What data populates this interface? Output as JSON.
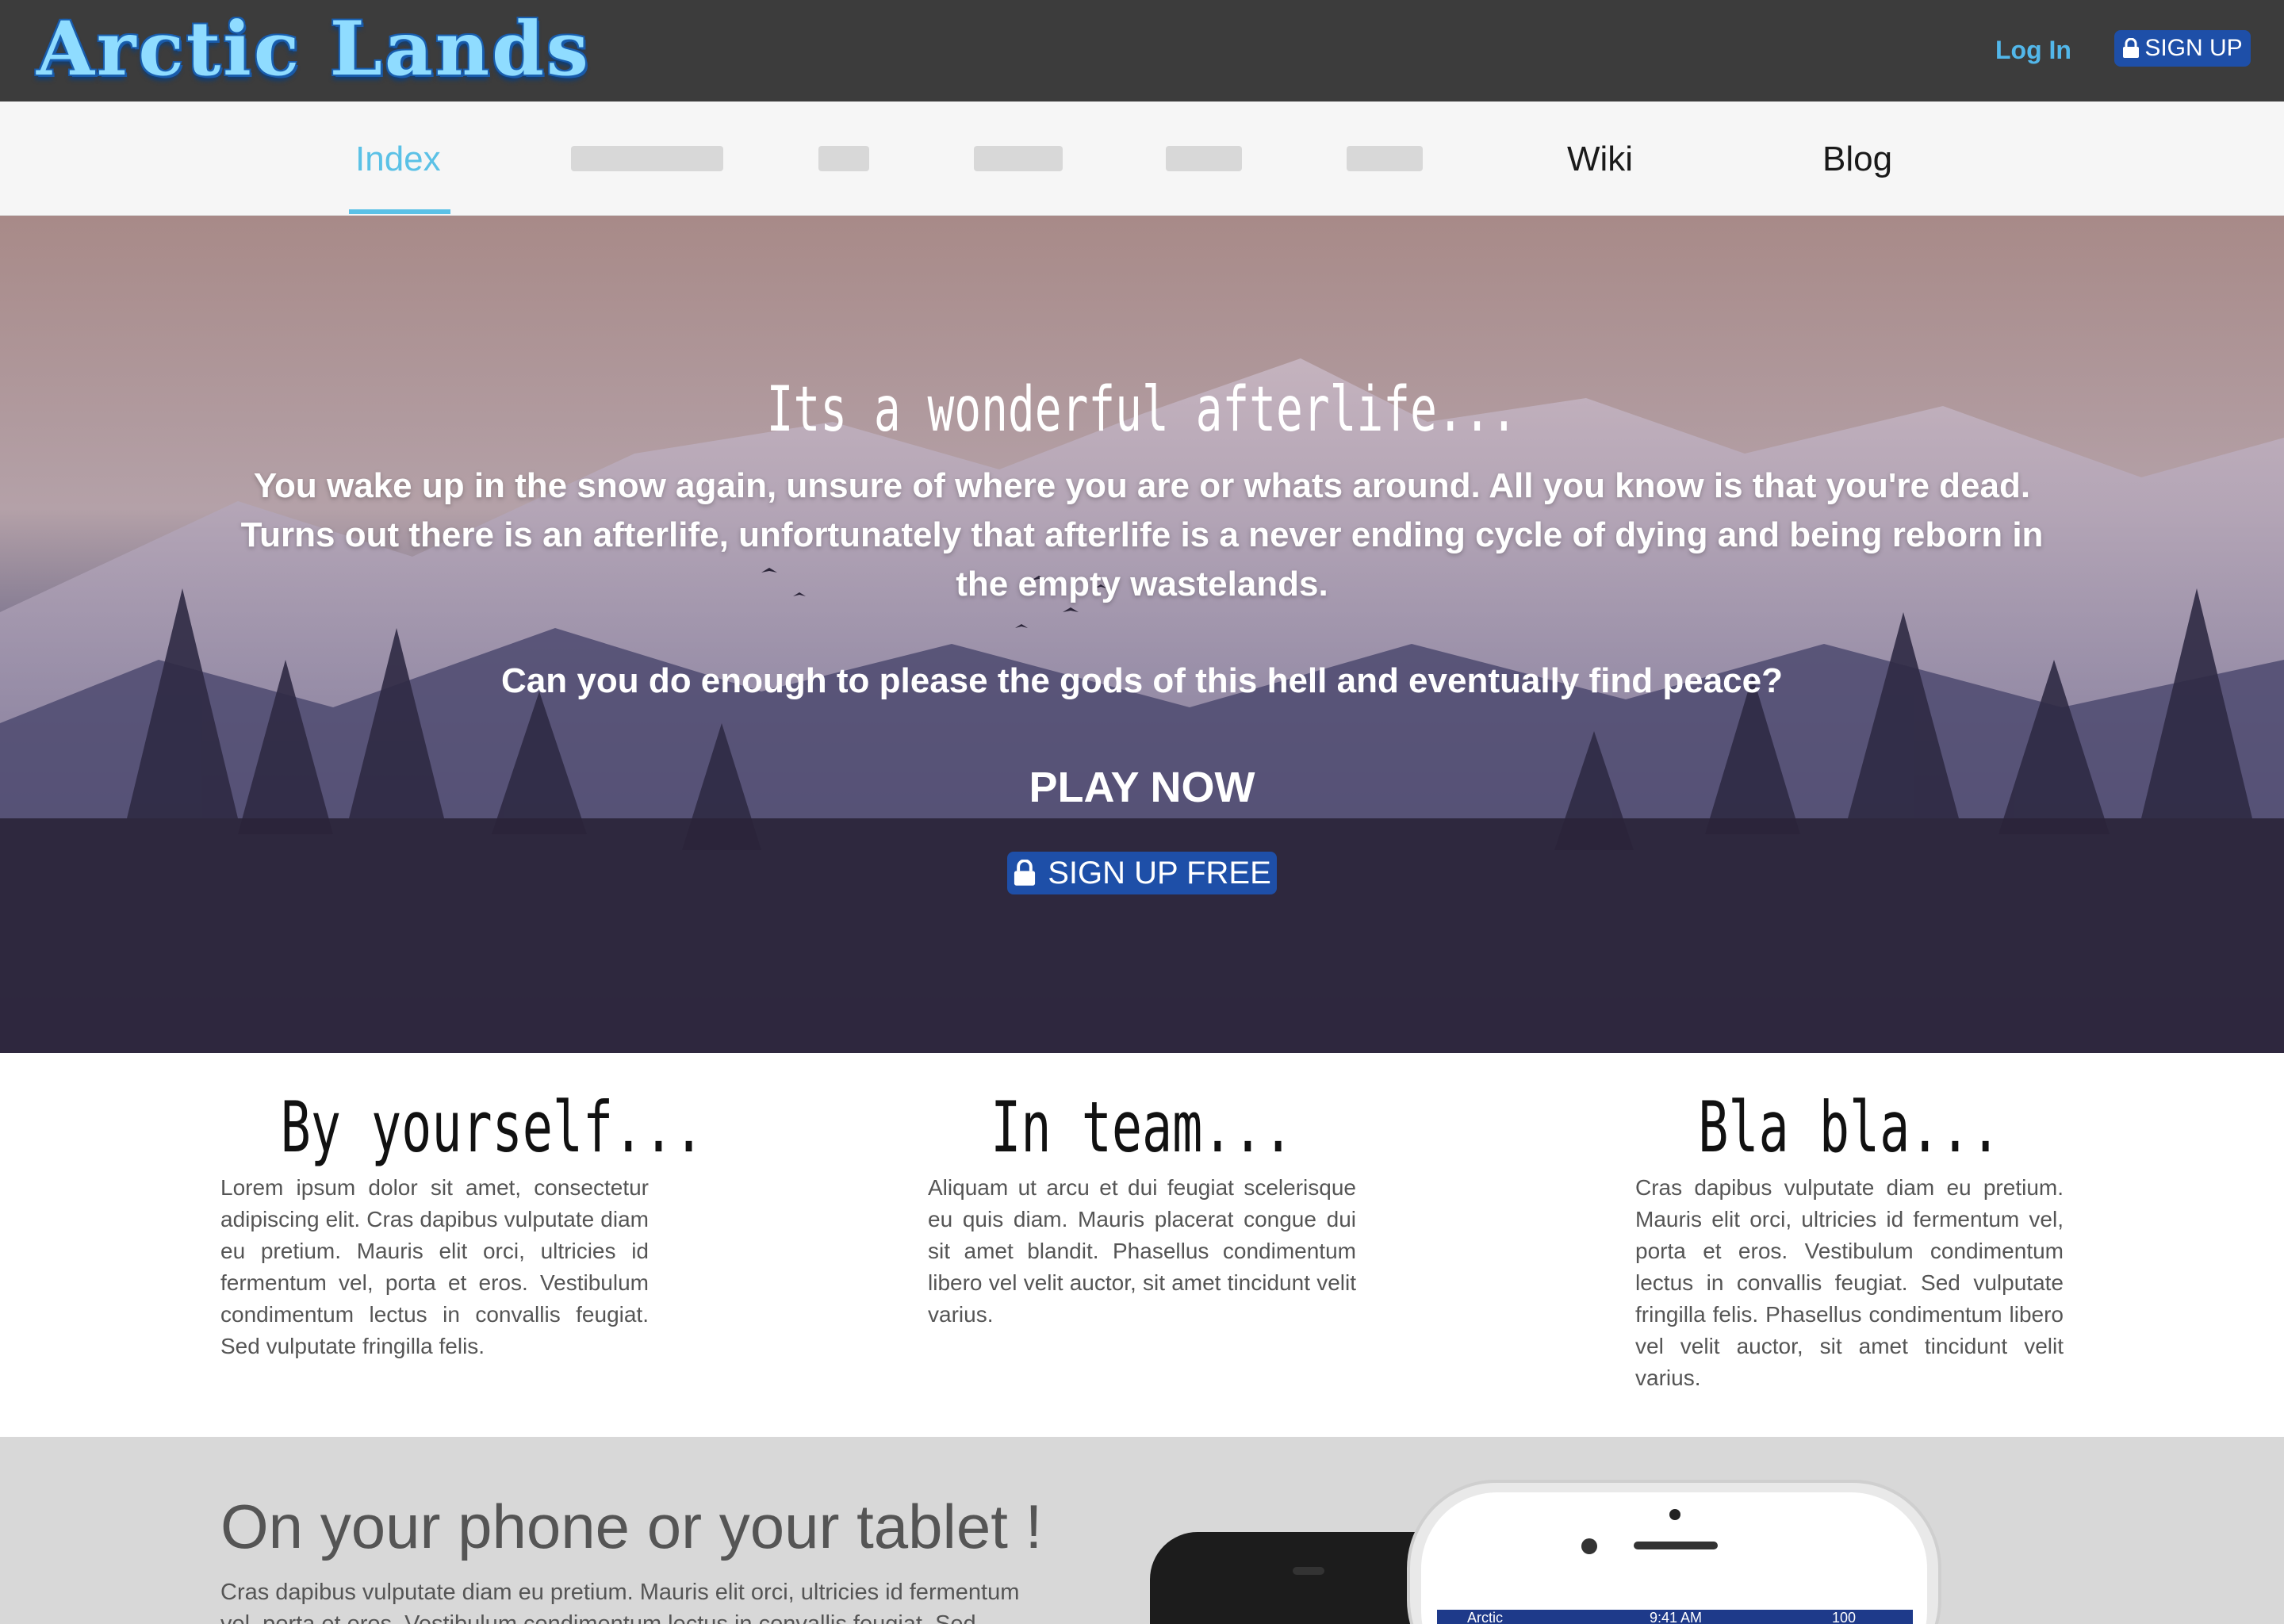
{
  "header": {
    "logo_text": "Arctic Lands",
    "login_label": "Log In",
    "signup_label": "SIGN UP"
  },
  "nav": {
    "items": [
      {
        "label": "Index",
        "active": true
      },
      {
        "label": "Wiki",
        "active": false
      },
      {
        "label": "Blog",
        "active": false
      }
    ]
  },
  "hero": {
    "title": "Its a wonderful afterlife...",
    "line1": "You wake up in the snow again, unsure of where you are or whats around. All you know is that you're dead. Turns out there is an afterlife, unfortunately that afterlife is a never ending cycle of dying and being reborn in the empty wastelands.",
    "question": "Can you do enough to please the gods of this hell and eventually find peace?",
    "play_label": "PLAY NOW",
    "signup_free_label": "SIGN UP FREE"
  },
  "features": [
    {
      "title": "By yourself...",
      "text": "Lorem ipsum dolor sit amet, consectetur adipiscing elit. Cras dapibus vulputate diam eu pretium. Mauris elit orci, ultricies id fermentum vel, porta et eros. Vestibulum condimentum lectus in convallis feugiat. Sed vulputate fringilla felis."
    },
    {
      "title": "In team...",
      "text": "Aliquam ut arcu et dui feugiat scelerisque eu quis diam. Mauris placerat congue dui sit amet blandit. Phasellus condimentum libero vel velit auctor, sit amet tincidunt velit varius."
    },
    {
      "title": "Bla bla...",
      "text": "Cras dapibus vulputate diam eu pretium. Mauris elit orci, ultricies id fermentum vel, porta et eros. Vestibulum condimentum lectus in convallis feugiat. Sed vulputate fringilla felis. Phasellus condimentum libero vel velit auctor, sit amet tincidunt velit varius."
    }
  ],
  "mobile": {
    "title": "On your phone or your tablet !",
    "text": "Cras dapibus vulputate diam eu pretium. Mauris elit orci, ultricies id fermentum vel, porta et eros. Vestibulum condimentum lectus in convallis feugiat. Sed vulputate",
    "phone_status_carrier": "Arctic",
    "phone_status_time": "9:41 AM",
    "phone_status_battery": "100"
  },
  "colors": {
    "topbar_bg": "#3c3c3c",
    "accent_blue": "#5bc1e6",
    "button_blue": "#1e4fa8",
    "nav_bg": "#f6f6f6",
    "mobile_bg": "#d8d8d8"
  },
  "icons": [
    "lock-icon"
  ]
}
